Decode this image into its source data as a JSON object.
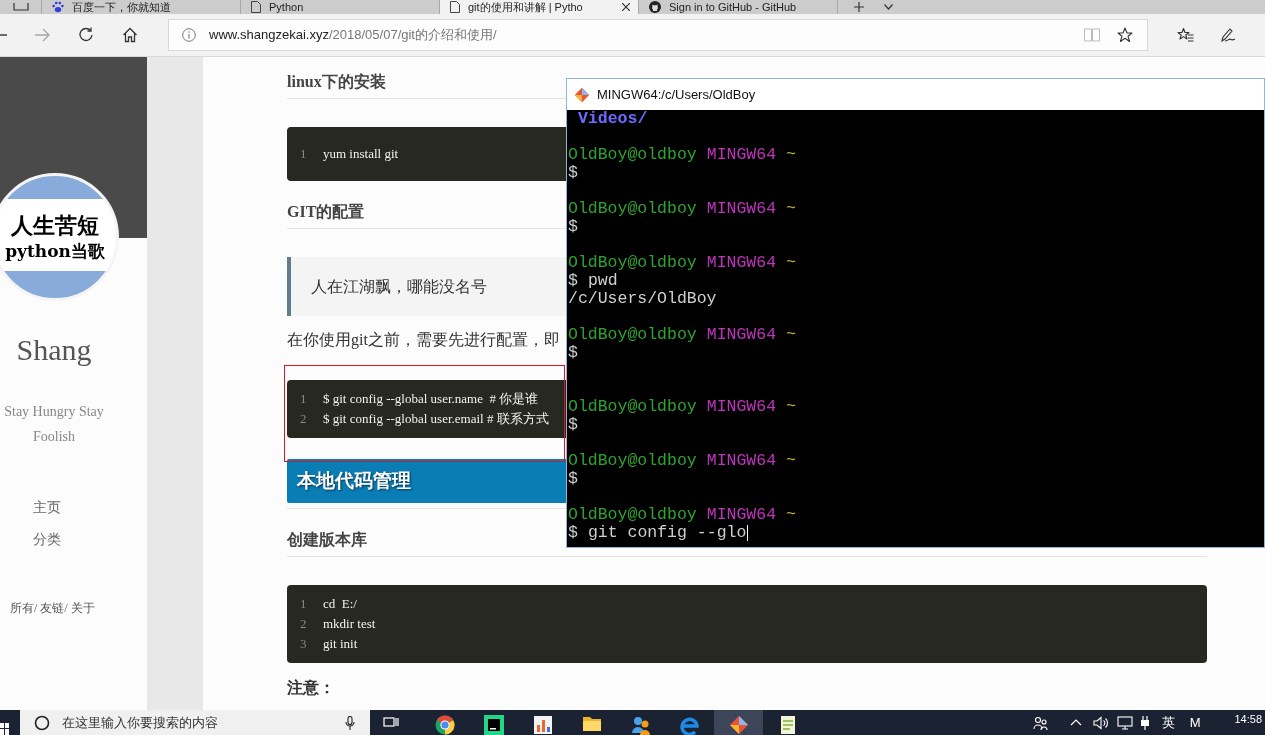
{
  "browser": {
    "tabs": [
      {
        "kind": "paw",
        "title": "百度一下，你就知道",
        "selected": false
      },
      {
        "kind": "page",
        "title": "Python",
        "selected": false
      },
      {
        "kind": "page",
        "title": "git的使用和讲解 | Pytho",
        "selected": true
      },
      {
        "kind": "round",
        "title": "Sign in to GitHub - GitHub",
        "selected": false
      }
    ],
    "address": {
      "host": "www.shangzekai.xyz",
      "path": "/2018/05/07/git的介绍和使用/"
    }
  },
  "sidebar": {
    "avatar_text": [
      "人生苦短",
      "python当歌"
    ],
    "name": "Shang",
    "motto": "Stay Hungry Stay Foolish",
    "nav": [
      "主页",
      "分类"
    ],
    "footer_links": [
      "所有/",
      "友链/",
      "关于"
    ]
  },
  "article": {
    "blocks": [
      {
        "kind": "heading",
        "text": "linux下的安装"
      },
      {
        "kind": "code",
        "highlighted": false,
        "lines": [
          {
            "number": "1",
            "code": "yum install git"
          }
        ]
      },
      {
        "kind": "heading",
        "text": "GIT的配置"
      },
      {
        "kind": "quote",
        "text": "人在江湖飘，哪能没名号"
      },
      {
        "kind": "paragraph",
        "text": "在你使用git之前，需要先进行配置，即"
      },
      {
        "kind": "code",
        "highlighted": true,
        "lines": [
          {
            "number": "1",
            "code": "$ git config --global user.name  # 你是谁"
          },
          {
            "number": "2",
            "code": "$ git config --global user.email # 联系方式"
          }
        ]
      },
      {
        "kind": "banner",
        "text": "本地代码管理"
      },
      {
        "kind": "heading",
        "text": "创建版本库"
      },
      {
        "kind": "code",
        "highlighted": false,
        "lines": [
          {
            "number": "1",
            "code": "cd  E:/"
          },
          {
            "number": "2",
            "code": "mkdir test"
          },
          {
            "number": "3",
            "code": "git init"
          }
        ]
      },
      {
        "kind": "label",
        "text": "注意："
      }
    ]
  },
  "terminal": {
    "title": "MINGW64:/c/Users/OldBoy",
    "lines": [
      {
        "kind": "dir",
        "text": "Videos/"
      },
      {
        "kind": "blank"
      },
      {
        "kind": "prompt",
        "user": "OldBoy@oldboy",
        "system": "MINGW64",
        "path": "~"
      },
      {
        "kind": "command",
        "sign": "$"
      },
      {
        "kind": "blank"
      },
      {
        "kind": "prompt",
        "user": "OldBoy@oldboy",
        "system": "MINGW64",
        "path": "~"
      },
      {
        "kind": "command",
        "sign": "$"
      },
      {
        "kind": "blank"
      },
      {
        "kind": "prompt",
        "user": "OldBoy@oldboy",
        "system": "MINGW64",
        "path": "~"
      },
      {
        "kind": "command",
        "sign": "$",
        "text": "pwd"
      },
      {
        "kind": "output",
        "text": "/c/Users/OldBoy"
      },
      {
        "kind": "blank"
      },
      {
        "kind": "prompt",
        "user": "OldBoy@oldboy",
        "system": "MINGW64",
        "path": "~"
      },
      {
        "kind": "command",
        "sign": "$"
      },
      {
        "kind": "blank"
      },
      {
        "kind": "blank"
      },
      {
        "kind": "prompt",
        "user": "OldBoy@oldboy",
        "system": "MINGW64",
        "path": "~"
      },
      {
        "kind": "command",
        "sign": "$"
      },
      {
        "kind": "blank"
      },
      {
        "kind": "prompt",
        "user": "OldBoy@oldboy",
        "system": "MINGW64",
        "path": "~"
      },
      {
        "kind": "command",
        "sign": "$"
      },
      {
        "kind": "blank"
      },
      {
        "kind": "prompt",
        "user": "OldBoy@oldboy",
        "system": "MINGW64",
        "path": "~"
      },
      {
        "kind": "command",
        "sign": "$",
        "text": "git config --glo",
        "cursor": true
      }
    ]
  },
  "taskbar": {
    "search": {
      "placeholder": "在这里输入你要搜索的内容"
    },
    "apps": [
      {
        "kind": "ring",
        "selected": false
      },
      {
        "kind": "square",
        "selected": false
      },
      {
        "kind": "chart",
        "selected": false
      },
      {
        "kind": "folder",
        "selected": false
      },
      {
        "kind": "people",
        "selected": false
      },
      {
        "kind": "swirl",
        "selected": false
      },
      {
        "kind": "diamond",
        "selected": true
      },
      {
        "kind": "notepad",
        "selected": false
      }
    ],
    "tray": [
      "英",
      "M"
    ],
    "clock": "14:58"
  }
}
